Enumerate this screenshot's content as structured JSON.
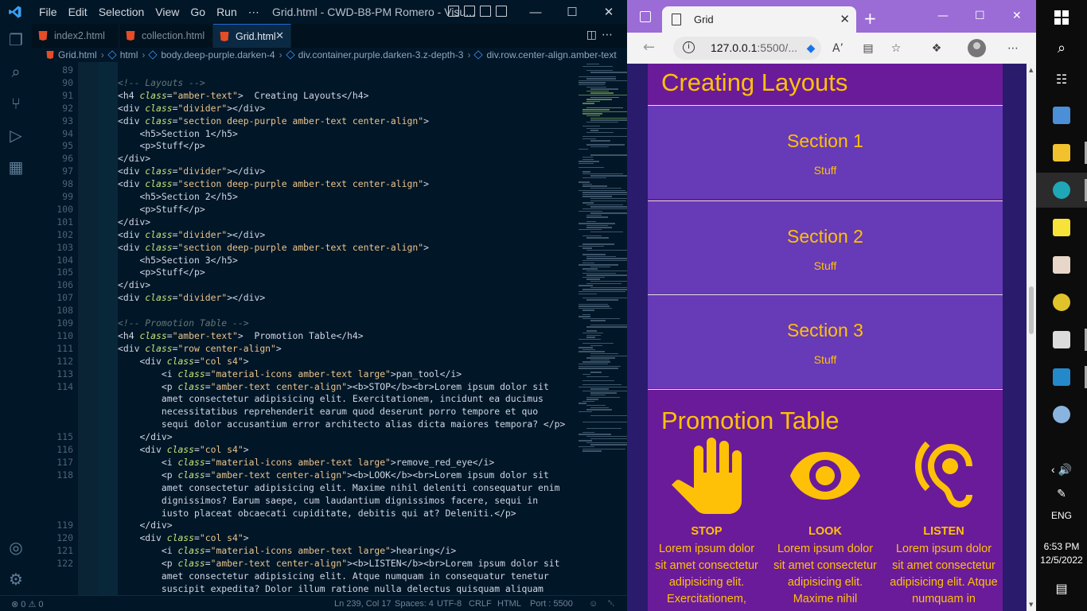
{
  "vscode": {
    "menu": [
      "File",
      "Edit",
      "Selection",
      "View",
      "Go",
      "Run",
      "⋯"
    ],
    "window_title": "Grid.html - CWD-B8-PM Romero - Visu...",
    "tabs": [
      {
        "label": "index2.html",
        "active": false
      },
      {
        "label": "collection.html",
        "active": false
      },
      {
        "label": "Grid.html",
        "active": true
      }
    ],
    "breadcrumbs": [
      "Grid.html",
      "html",
      "body.deep-purple.darken-4",
      "div.container.purple.darken-3.z-depth-3",
      "div.row.center-align.amber-text"
    ],
    "line_numbers": [
      "89",
      "90",
      "91",
      "92",
      "93",
      "94",
      "95",
      "96",
      "97",
      "98",
      "99",
      "100",
      "101",
      "102",
      "103",
      "104",
      "105",
      "106",
      "107",
      "108",
      "109",
      "110",
      "111",
      "112",
      "113",
      "114",
      "",
      "",
      "",
      "115",
      "116",
      "117",
      "118",
      "",
      "",
      "",
      "119",
      "120",
      "121",
      "122",
      "",
      "",
      ""
    ],
    "status": {
      "problems": "⊗ 0 ⚠ 0",
      "position": "Ln 239, Col 17",
      "spaces": "Spaces: 4",
      "encoding": "UTF-8",
      "eol": "CRLF",
      "language": "HTML",
      "port": "Port : 5500"
    }
  },
  "browser": {
    "tab_title": "Grid",
    "url_host": "127.0.0.1",
    "url_rest": ":5500/...",
    "page": {
      "heading1": "Creating Layouts",
      "sections": [
        {
          "title": "Section 1",
          "text": "Stuff"
        },
        {
          "title": "Section 2",
          "text": "Stuff"
        },
        {
          "title": "Section 3",
          "text": "Stuff"
        }
      ],
      "heading2": "Promotion Table",
      "promos": [
        {
          "icon": "pan-tool-icon",
          "label": "STOP",
          "text": "Lorem ipsum dolor sit amet consectetur adipisicing elit. Exercitationem,"
        },
        {
          "icon": "remove-red-eye-icon",
          "label": "LOOK",
          "text": "Lorem ipsum dolor sit amet consectetur adipisicing elit. Maxime nihil"
        },
        {
          "icon": "hearing-icon",
          "label": "LISTEN",
          "text": "Lorem ipsum dolor sit amet consectetur adipisicing elit. Atque numquam in"
        }
      ]
    },
    "colors": {
      "purple_darken_3": "#6a1b9a",
      "deep_purple": "#673ab7",
      "amber": "#ffc107",
      "deep_purple_darken_4": "#2a1b6d"
    }
  },
  "taskbar": {
    "tray_language": "ENG",
    "time": "6:53 PM",
    "date": "12/5/2022"
  }
}
